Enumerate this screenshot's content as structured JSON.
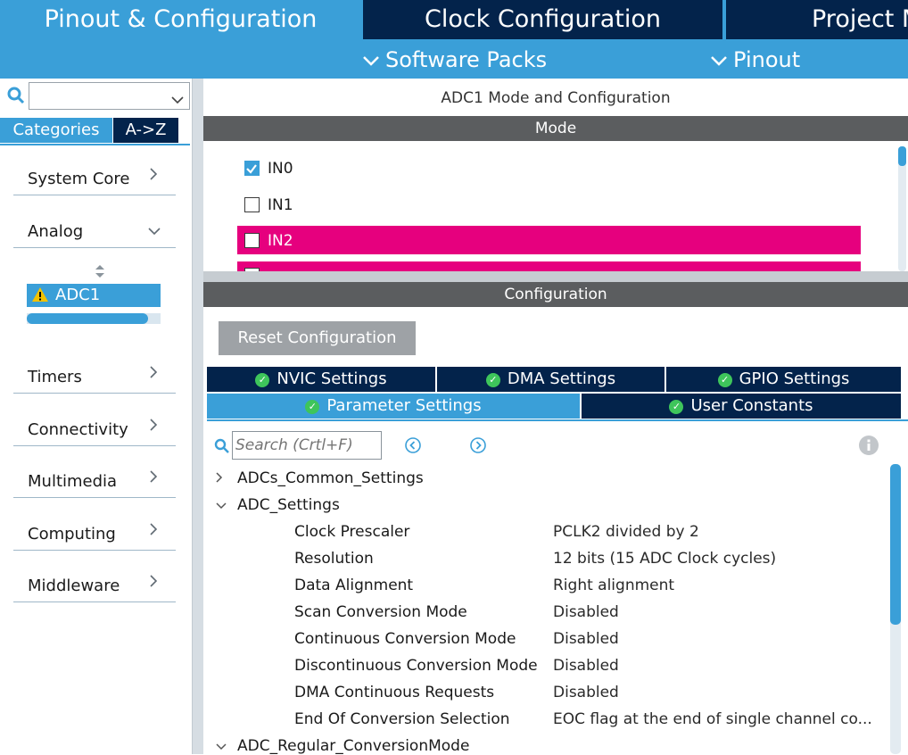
{
  "top_tabs": [
    {
      "label": "Pinout & Configuration"
    },
    {
      "label": "Clock Configuration"
    },
    {
      "label": "Project M"
    }
  ],
  "sub_tabs": [
    {
      "label": "Software Packs"
    },
    {
      "label": "Pinout"
    }
  ],
  "left": {
    "search_value": "",
    "view_tabs": [
      "Categories",
      "A->Z"
    ],
    "categories": {
      "system_core": "System Core",
      "analog": "Analog",
      "timers": "Timers",
      "connectivity": "Connectivity",
      "multimedia": "Multimedia",
      "computing": "Computing",
      "middleware": "Middleware"
    },
    "analog_items": [
      {
        "label": "ADC1",
        "status": "warning"
      }
    ]
  },
  "main": {
    "title": "ADC1 Mode and Configuration",
    "mode_header": "Mode",
    "mode_items": [
      {
        "label": "IN0",
        "checked": true
      },
      {
        "label": "IN1",
        "checked": false
      },
      {
        "label": "IN2",
        "checked": false,
        "highlighted": true
      }
    ],
    "config_header": "Configuration",
    "reset_button": "Reset Configuration",
    "config_tabs_row1": [
      "NVIC Settings",
      "DMA Settings",
      "GPIO Settings"
    ],
    "config_tabs_row2": [
      "Parameter Settings",
      "User Constants"
    ],
    "search_placeholder": "Search (Crtl+F)",
    "tree": {
      "group1": "ADCs_Common_Settings",
      "group2": "ADC_Settings",
      "group3": "ADC_Regular_ConversionMode"
    },
    "params": [
      {
        "name": "Clock Prescaler",
        "value": "PCLK2 divided by 2"
      },
      {
        "name": "Resolution",
        "value": "12 bits (15 ADC Clock cycles)"
      },
      {
        "name": "Data Alignment",
        "value": "Right alignment"
      },
      {
        "name": "Scan Conversion Mode",
        "value": "Disabled"
      },
      {
        "name": "Continuous Conversion Mode",
        "value": "Disabled"
      },
      {
        "name": "Discontinuous Conversion Mode",
        "value": "Disabled"
      },
      {
        "name": "DMA Continuous Requests",
        "value": "Disabled"
      },
      {
        "name": "End Of Conversion Selection",
        "value": "EOC flag at the end of single channel co..."
      }
    ]
  },
  "colors": {
    "accent_blue": "#3a9fd8",
    "dark_navy": "#03234b",
    "highlight_magenta": "#e6007e",
    "section_gray": "#5b5d5f"
  }
}
